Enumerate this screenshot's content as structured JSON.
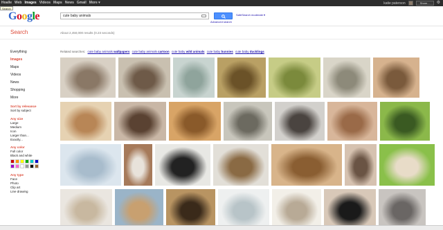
{
  "topbar": {
    "nav": [
      "Hoalle",
      "Web",
      "Images",
      "Videos",
      "Maps",
      "News",
      "Gmail",
      "More ▾"
    ],
    "active_index": 2,
    "user": "katie paterson",
    "share": "Share..."
  },
  "tooltip": "Search",
  "logo": {
    "G": "G",
    "o1": "o",
    "o2": "o",
    "g": "g",
    "l": "l",
    "e": "e"
  },
  "search": {
    "query": "cute baby animals",
    "advanced": "Advanced search",
    "safesearch": "SafeSearch moderate ▾"
  },
  "page_title": "Search",
  "results_count": "About 2,450,000 results (0.23 seconds)",
  "sidebar": {
    "nav": [
      "Everything",
      "Images",
      "Maps",
      "Videos",
      "News",
      "Shopping",
      "More"
    ],
    "active_index": 1,
    "sort_title": "Sort by relevance",
    "sort_opt": "Sort by subject",
    "size_title": "Any size",
    "size_opts": [
      "Large",
      "Medium",
      "Icon",
      "Larger than...",
      "Exactly..."
    ],
    "color_title": "Any color",
    "color_opts": [
      "Full color",
      "Black and white"
    ],
    "swatches": [
      "#cc0000",
      "#ff9900",
      "#ffff00",
      "#00aa00",
      "#00cccc",
      "#0000cc",
      "#9900cc",
      "#ff66cc",
      "#ffffff",
      "#999999",
      "#000000",
      "#996633"
    ],
    "type_title": "Any type",
    "type_opts": [
      "Face",
      "Photo",
      "Clip art",
      "Line drawing"
    ]
  },
  "related": {
    "label": "Related searches:",
    "links": [
      [
        "cute baby animals ",
        "wallpapers"
      ],
      [
        "cute baby animals ",
        "cartoon"
      ],
      [
        "cute baby ",
        "wild animals"
      ],
      [
        "cute baby ",
        "bunnies"
      ],
      [
        "cute baby ",
        "ducklings"
      ]
    ]
  },
  "thumbs": [
    {
      "name": "thumb-mouse-teddy",
      "c1": "#d8d0c4",
      "c2": "#8a7866"
    },
    {
      "name": "thumb-mouse-toy",
      "c1": "#c9c0b0",
      "c2": "#6e5a48"
    },
    {
      "name": "thumb-snail-blanket",
      "c1": "#c8d4d0",
      "c2": "#8fa49c"
    },
    {
      "name": "thumb-ducklings-pile",
      "c1": "#b9a064",
      "c2": "#6b5228"
    },
    {
      "name": "thumb-duckling-chick",
      "c1": "#c6cc86",
      "c2": "#7b8a3c"
    },
    {
      "name": "thumb-polar-bear-cubs",
      "c1": "#d9d5c8",
      "c2": "#8d8a7a"
    },
    {
      "name": "thumb-hamster-hand",
      "c1": "#d6b28e",
      "c2": "#7a5a3c"
    },
    {
      "name": "thumb-bunny",
      "c1": "#e6d2b2",
      "c2": "#b88656"
    },
    {
      "name": "thumb-bottle-feeding",
      "c1": "#c9b7a6",
      "c2": "#5a4232"
    },
    {
      "name": "thumb-puppies-pair",
      "c1": "#d8a466",
      "c2": "#8a5a2a"
    },
    {
      "name": "thumb-turtle-coins",
      "c1": "#c8c6bc",
      "c2": "#6c6a60"
    },
    {
      "name": "thumb-puppy-running",
      "c1": "#d2d0cc",
      "c2": "#4a4440"
    },
    {
      "name": "thumb-hedgehog-finger",
      "c1": "#d8b69a",
      "c2": "#9a6a48"
    },
    {
      "name": "thumb-dalmatian-puppies",
      "c1": "#8bb84a",
      "c2": "#3a5a22"
    },
    {
      "name": "thumb-seal-pup",
      "c1": "#dce6ee",
      "c2": "#a8bccc"
    },
    {
      "name": "thumb-baby-kangaroo",
      "c1": "#a67a5a",
      "c2": "#e8e2da"
    },
    {
      "name": "thumb-panda-cubs",
      "c1": "#e8e8e4",
      "c2": "#222222"
    },
    {
      "name": "thumb-kitten-calico",
      "c1": "#e2dfd8",
      "c2": "#8a6a44"
    },
    {
      "name": "thumb-puppy-sleeping",
      "c1": "#d8b48a",
      "c2": "#8a5e32"
    },
    {
      "name": "thumb-kitten-hand",
      "c1": "#d6c2b0",
      "c2": "#6a5444"
    },
    {
      "name": "thumb-hamster-green",
      "c1": "#8ac04a",
      "c2": "#e8dcc8"
    },
    {
      "name": "thumb-white-kitten-rug",
      "c1": "#eae6e0",
      "c2": "#c8b8a0"
    },
    {
      "name": "thumb-puppy-duo-snow",
      "c1": "#9ab4c8",
      "c2": "#c8a070"
    },
    {
      "name": "thumb-tiger-cubs",
      "c1": "#b89462",
      "c2": "#3a2a1a"
    },
    {
      "name": "thumb-polar-cub-white",
      "c1": "#eef0f0",
      "c2": "#b8c4c8"
    },
    {
      "name": "thumb-white-puppies",
      "c1": "#f2efe8",
      "c2": "#b8aa96"
    },
    {
      "name": "thumb-skunk-baby",
      "c1": "#d8c8b8",
      "c2": "#1a1a1a"
    },
    {
      "name": "thumb-kittens-gray",
      "c1": "#c8c4c0",
      "c2": "#6a6664"
    }
  ]
}
